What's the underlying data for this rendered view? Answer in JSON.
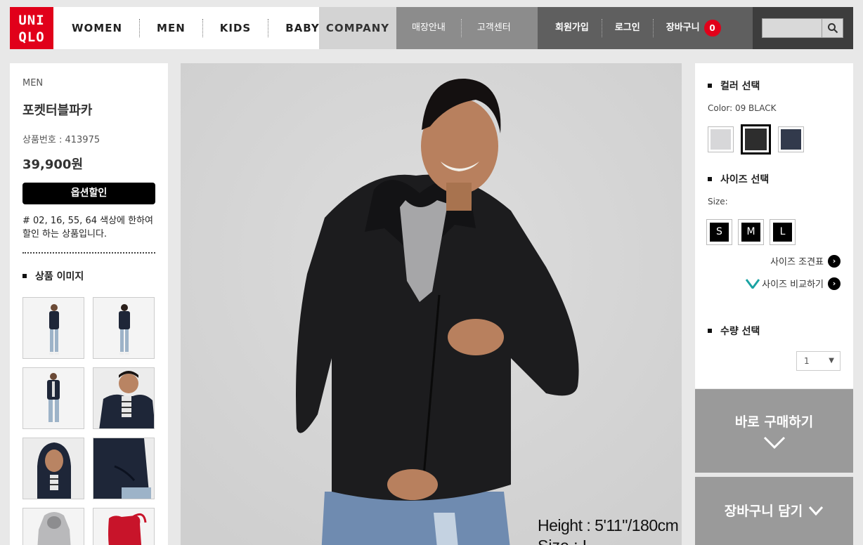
{
  "brand": {
    "logo_line1": "UNI",
    "logo_line2": "QLO",
    "color": "#e1001a"
  },
  "nav": {
    "main": [
      "WOMEN",
      "MEN",
      "KIDS",
      "BABY"
    ],
    "company": "COMPANY",
    "info": [
      "매장안내",
      "고객센터"
    ],
    "account": [
      "회원가입",
      "로그인",
      "장바구니"
    ],
    "cart_count": "0",
    "search_placeholder": ""
  },
  "product": {
    "category": "MEN",
    "name": "포켓터블파카",
    "code": "상품번호 : 413975",
    "price": "39,900원",
    "discount_label": "옵션할인",
    "discount_note": "# 02, 16, 55, 64 색상에 한하여 할인 하는 상품입니다."
  },
  "images": {
    "heading": "상품 이미지",
    "thumbnails": [
      {
        "name": "front-full"
      },
      {
        "name": "back-full"
      },
      {
        "name": "front-open"
      },
      {
        "name": "closeup-side"
      },
      {
        "name": "hood-up"
      },
      {
        "name": "pocket-detail"
      },
      {
        "name": "gray-parka"
      },
      {
        "name": "red-pouch"
      }
    ],
    "model_height": "Height : 5'11\"/180cm",
    "model_size": "Size : L"
  },
  "options": {
    "color_heading": "컬러 선택",
    "color_label": "Color: 09 BLACK",
    "colors": [
      {
        "name": "light-gray",
        "hex": "#d7d7d9"
      },
      {
        "name": "black",
        "hex": "#2d2d2d",
        "selected": true
      },
      {
        "name": "navy",
        "hex": "#323a4c"
      }
    ],
    "size_heading": "사이즈 선택",
    "size_label": "Size:",
    "sizes": [
      "S",
      "M",
      "L"
    ],
    "size_chart_link": "사이즈 조견표",
    "size_compare_link": "사이즈 비교하기",
    "qty_heading": "수량 선택",
    "qty_value": "1"
  },
  "actions": {
    "buy_now": "바로 구매하기",
    "add_to_cart": "장바구니 담기"
  }
}
